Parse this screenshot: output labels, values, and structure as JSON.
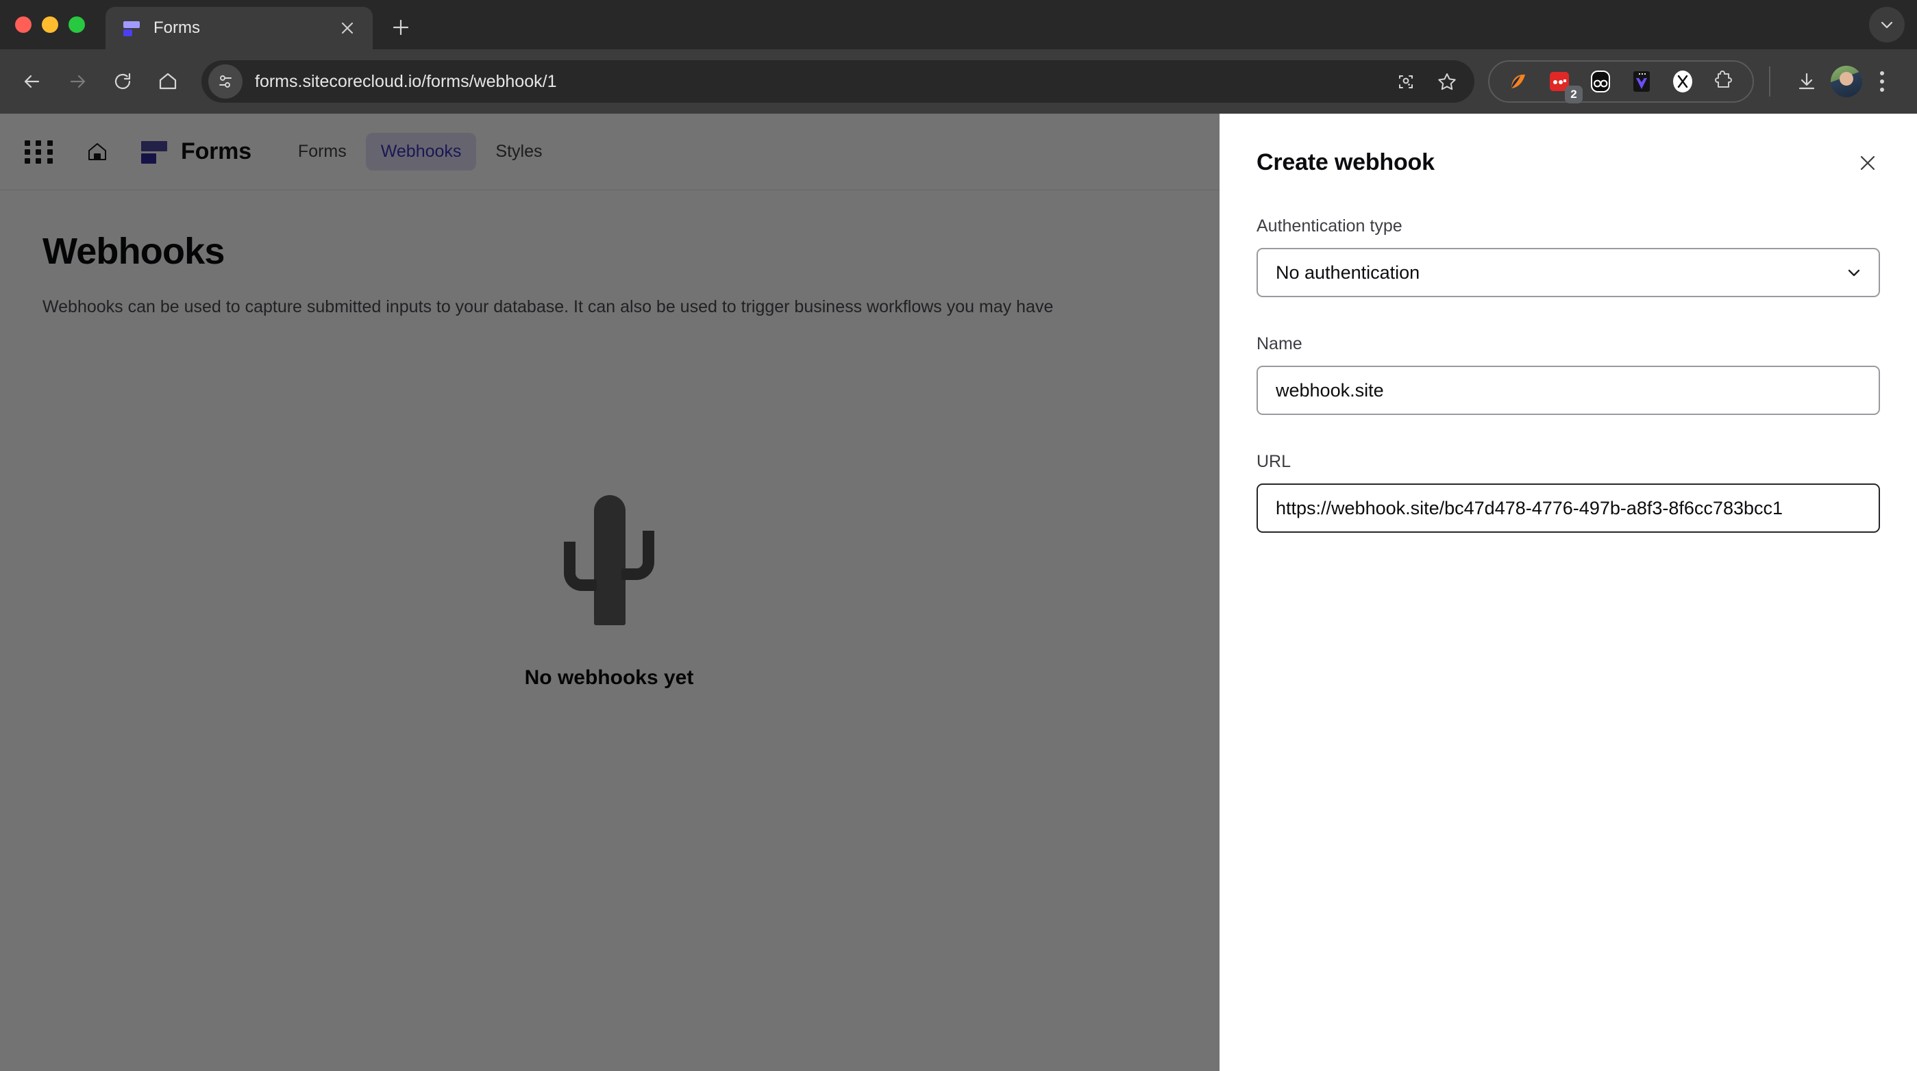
{
  "browser": {
    "tab": {
      "title": "Forms",
      "favicon": "forms-logo-icon",
      "close": "×"
    },
    "new_tab_label": "+",
    "nav": {
      "back": "back-arrow-icon",
      "forward": "forward-arrow-icon",
      "reload": "reload-icon",
      "home": "home-icon"
    },
    "omnibox": {
      "url": "forms.sitecorecloud.io/forms/webhook/1",
      "site_info_icon": "tune-site-settings-icon",
      "search_image_icon": "google-lens-icon",
      "bookmark_icon": "star-icon"
    },
    "extensions": [
      {
        "name": "sitecore-extension-icon",
        "badge": ""
      },
      {
        "name": "red-extension-icon",
        "badge": "2"
      },
      {
        "name": "oo-extension-icon",
        "badge": ""
      },
      {
        "name": "purple-app-extension-icon",
        "badge": ""
      },
      {
        "name": "x-extension-icon",
        "badge": ""
      },
      {
        "name": "puzzle-extensions-icon",
        "badge": ""
      }
    ],
    "downloads_icon": "download-icon",
    "profile_icon": "profile-avatar",
    "menu_icon": "chrome-menu-icon",
    "collapse_icon": "chevron-down-icon"
  },
  "app": {
    "apps_grid_icon": "apps-grid-icon",
    "home_icon": "home-icon",
    "brand": "Forms",
    "nav_items": [
      {
        "label": "Forms",
        "active": false
      },
      {
        "label": "Webhooks",
        "active": true
      },
      {
        "label": "Styles",
        "active": false
      }
    ]
  },
  "main": {
    "title": "Webhooks",
    "subtitle": "Webhooks can be used to capture submitted inputs to your database. It can also be used to trigger business workflows you may have",
    "empty_state": {
      "illustration": "cactus-icon",
      "label": "No webhooks yet"
    }
  },
  "panel": {
    "title": "Create webhook",
    "close_label": "×",
    "fields": {
      "auth": {
        "label": "Authentication type",
        "value": "No authentication",
        "chevron": "chevron-down-icon"
      },
      "name": {
        "label": "Name",
        "value": "webhook.site",
        "placeholder": "Name"
      },
      "url": {
        "label": "URL",
        "value": "https://webhook.site/bc47d478-4776-497b-a8f3-8f6cc783bcc1",
        "placeholder": "URL"
      }
    }
  },
  "colors": {
    "accent": "#3b34bd",
    "accent_bg": "#e3e1f7",
    "brand_dark": "#2f2a9c",
    "chrome_top": "#282828",
    "chrome_toolbar": "#3c3c3c",
    "overlay": "rgba(0,0,0,0.55)"
  }
}
